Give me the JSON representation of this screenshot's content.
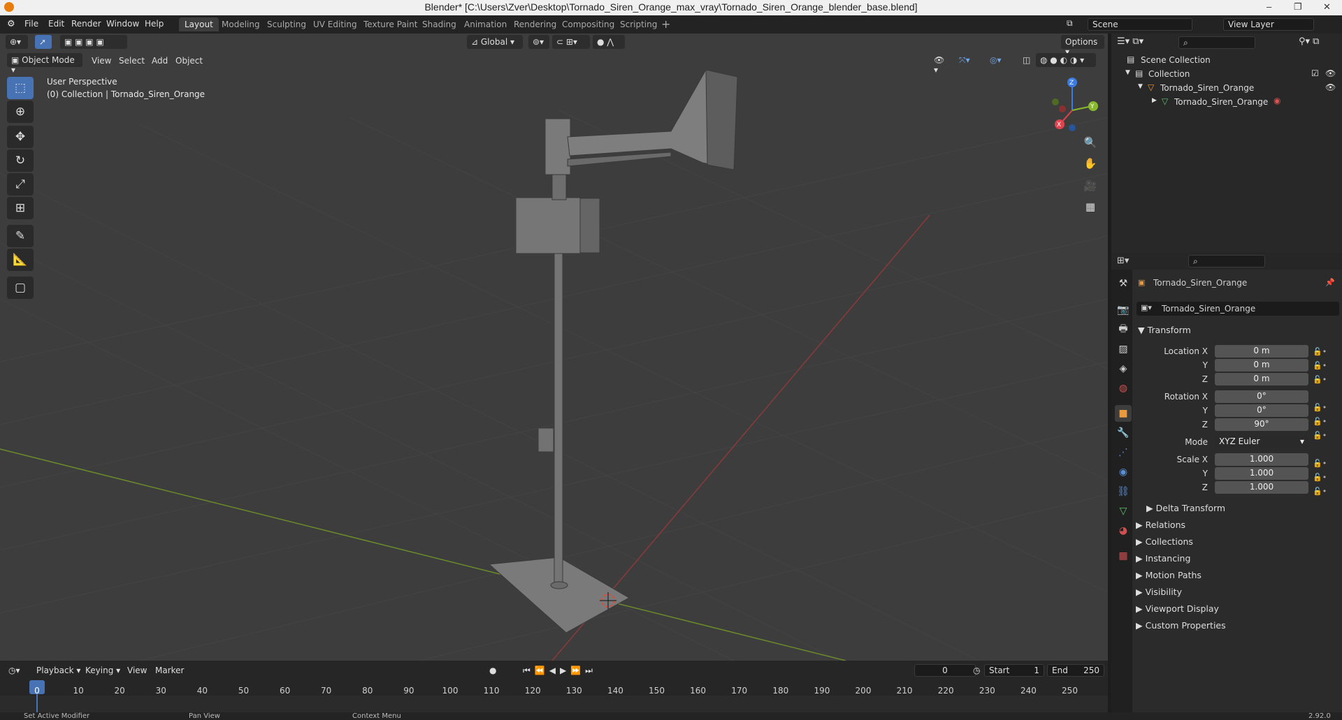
{
  "window": {
    "title": "Blender* [C:\\Users\\Zver\\Desktop\\Tornado_Siren_Orange_max_vray\\Tornado_Siren_Orange_blender_base.blend]"
  },
  "menu": [
    "File",
    "Edit",
    "Render",
    "Window",
    "Help"
  ],
  "workspaces": [
    "Layout",
    "Modeling",
    "Sculpting",
    "UV Editing",
    "Texture Paint",
    "Shading",
    "Animation",
    "Rendering",
    "Compositing",
    "Scripting"
  ],
  "active_workspace": "Layout",
  "scene": {
    "name": "Scene",
    "view_layer": "View Layer"
  },
  "header": {
    "orientation": "Global",
    "options": "Options"
  },
  "viewport": {
    "mode": "Object Mode",
    "menus": [
      "View",
      "Select",
      "Add",
      "Object"
    ],
    "overlay_title": "User Perspective",
    "overlay_sub": "(0) Collection | Tornado_Siren_Orange",
    "gizmo": {
      "x": "X",
      "y": "Y",
      "z": "Z"
    }
  },
  "timeline": {
    "menus": [
      "Playback",
      "Keying",
      "View",
      "Marker"
    ],
    "current_frame": "0",
    "start_label": "Start",
    "start": "1",
    "end_label": "End",
    "end": "250",
    "ticks": [
      "0",
      "10",
      "20",
      "30",
      "40",
      "50",
      "60",
      "70",
      "80",
      "90",
      "100",
      "110",
      "120",
      "130",
      "140",
      "150",
      "160",
      "170",
      "180",
      "190",
      "200",
      "210",
      "220",
      "230",
      "240",
      "250"
    ]
  },
  "outliner": {
    "scene_collection": "Scene Collection",
    "collection": "Collection",
    "object": "Tornado_Siren_Orange",
    "mesh": "Tornado_Siren_Orange"
  },
  "properties": {
    "object_name": "Tornado_Siren_Orange",
    "datablock": "Tornado_Siren_Orange",
    "transform_label": "Transform",
    "location": {
      "label": "Location X",
      "x": "0 m",
      "y": "0 m",
      "z": "0 m"
    },
    "rotation": {
      "label": "Rotation X",
      "x": "0°",
      "y": "0°",
      "z": "90°"
    },
    "mode_label": "Mode",
    "mode": "XYZ Euler",
    "scale": {
      "label": "Scale X",
      "x": "1.000",
      "y": "1.000",
      "z": "1.000"
    },
    "axis_y": "Y",
    "axis_z": "Z",
    "sections": [
      "Delta Transform",
      "Relations",
      "Collections",
      "Instancing",
      "Motion Paths",
      "Visibility",
      "Viewport Display",
      "Custom Properties"
    ]
  },
  "status": {
    "left": "Set Active Modifier",
    "mid": "Pan View",
    "right": "Context Menu",
    "version": "2.92.0"
  }
}
